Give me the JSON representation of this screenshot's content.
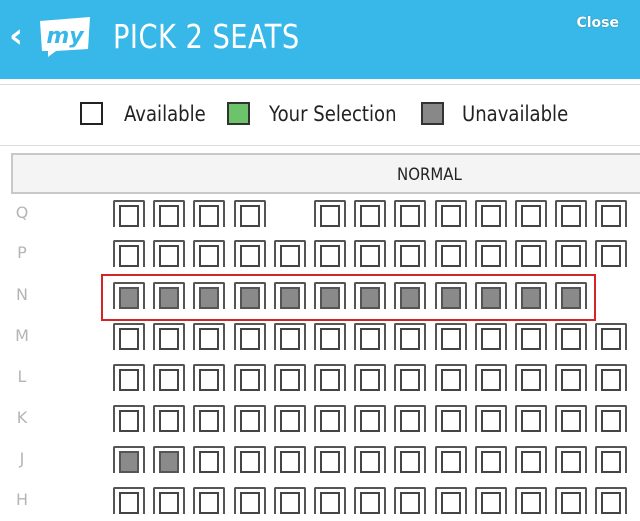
{
  "header": {
    "back_glyph": "‹",
    "logo_text": "my",
    "title": "PICK 2 SEATS",
    "close_label": "Close",
    "background_color": "#38b8e8"
  },
  "legend": {
    "available_label": "Available",
    "selection_label": "Your Selection",
    "unavailable_label": "Unavailable",
    "selection_color": "#6cc36a",
    "unavailable_color": "#888888"
  },
  "section": {
    "label": "NORMAL"
  },
  "highlight_color": "#d42424",
  "rows": [
    {
      "label": "Q",
      "seats": [
        "available",
        "available",
        "available",
        "available",
        "gap",
        "available",
        "available",
        "available",
        "available",
        "available",
        "available",
        "available",
        "available",
        "available"
      ]
    },
    {
      "label": "P",
      "seats": [
        "available",
        "available",
        "available",
        "available",
        "available",
        "available",
        "available",
        "available",
        "available",
        "available",
        "available",
        "available",
        "available"
      ]
    },
    {
      "label": "N",
      "seats": [
        "unavailable",
        "unavailable",
        "unavailable",
        "unavailable",
        "unavailable",
        "unavailable",
        "unavailable",
        "unavailable",
        "unavailable",
        "unavailable",
        "unavailable",
        "unavailable"
      ]
    },
    {
      "label": "M",
      "seats": [
        "available",
        "available",
        "available",
        "available",
        "available",
        "available",
        "available",
        "available",
        "available",
        "available",
        "available",
        "available",
        "available"
      ]
    },
    {
      "label": "L",
      "seats": [
        "available",
        "available",
        "available",
        "available",
        "available",
        "available",
        "available",
        "available",
        "available",
        "available",
        "available",
        "available",
        "available"
      ]
    },
    {
      "label": "K",
      "seats": [
        "available",
        "available",
        "available",
        "available",
        "available",
        "available",
        "available",
        "available",
        "available",
        "available",
        "available",
        "available",
        "available"
      ]
    },
    {
      "label": "J",
      "seats": [
        "unavailable",
        "unavailable",
        "available",
        "available",
        "available",
        "available",
        "available",
        "available",
        "available",
        "available",
        "available",
        "available",
        "available"
      ]
    },
    {
      "label": "H",
      "seats": [
        "available",
        "available",
        "available",
        "available",
        "available",
        "available",
        "available",
        "available",
        "available",
        "available",
        "available",
        "available",
        "available"
      ]
    }
  ]
}
